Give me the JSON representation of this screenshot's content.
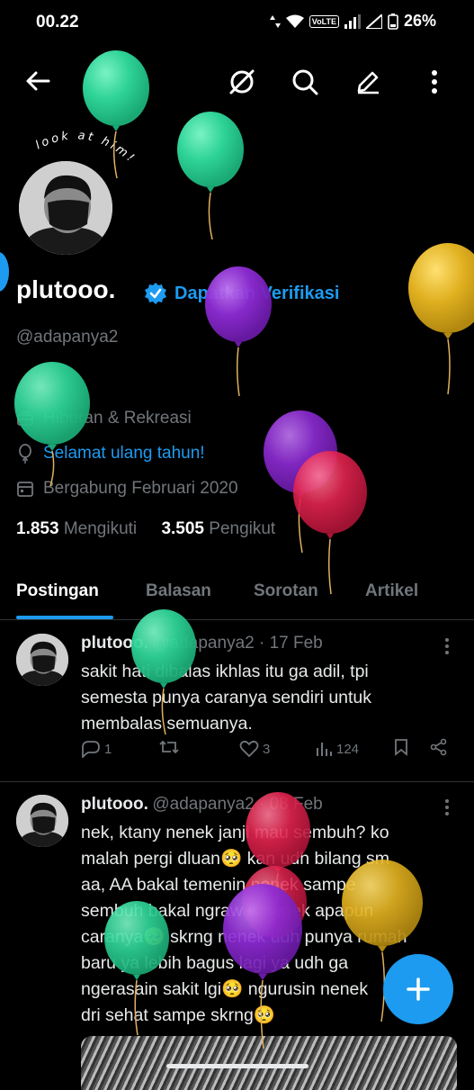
{
  "status_bar": {
    "time": "00.22",
    "volte": "VoLTE",
    "battery": "26%"
  },
  "profile": {
    "doodle_text": "look at him!",
    "display_name": "plutooo.",
    "verify_label": "Dapatkan Verifikasi",
    "handle": "@adapanya2",
    "category": "Hiburan & Rekreasi",
    "birthday_link": "Selamat ulang tahun!",
    "joined": "Bergabung Februari 2020",
    "following_count": "1.853",
    "following_label": "Mengikuti",
    "followers_count": "3.505",
    "followers_label": "Pengikut"
  },
  "tabs": [
    "Postingan",
    "Balasan",
    "Sorotan",
    "Artikel"
  ],
  "posts": [
    {
      "name": "plutooo.",
      "meta": "@adapanya2 · 17 Feb",
      "lines": [
        "sakit hati dibalas ikhlas itu ga adil, tpi",
        "semesta punya caranya sendiri untuk",
        "membalas semuanya."
      ],
      "replies": "1",
      "likes": "3",
      "views": "124"
    },
    {
      "name": "plutooo.",
      "meta": "@adapanya2 · 08 Feb",
      "lines": [
        "nek, ktany nenek janji mau sembuh? ko",
        "malah pergi dluan🥺 kan udh bilang sm",
        "aa, AA bakal temenin nenek sampe",
        "sembuh bakal ngrawat nenek apapun",
        "caranya🥺 skrng nenek udh punya rumah",
        "baru ya lebih bagus lagi ya udh ga",
        "ngerasain sakit lgi🥺 ngurusin nenek",
        "dri sehat sampe skrng🥺"
      ]
    }
  ],
  "colors": {
    "accent": "#1d9bf0",
    "balloon_green": "#2ed397",
    "balloon_purple": "#8e2bd6",
    "balloon_red": "#e3234f",
    "balloon_yellow": "#e0b020"
  }
}
